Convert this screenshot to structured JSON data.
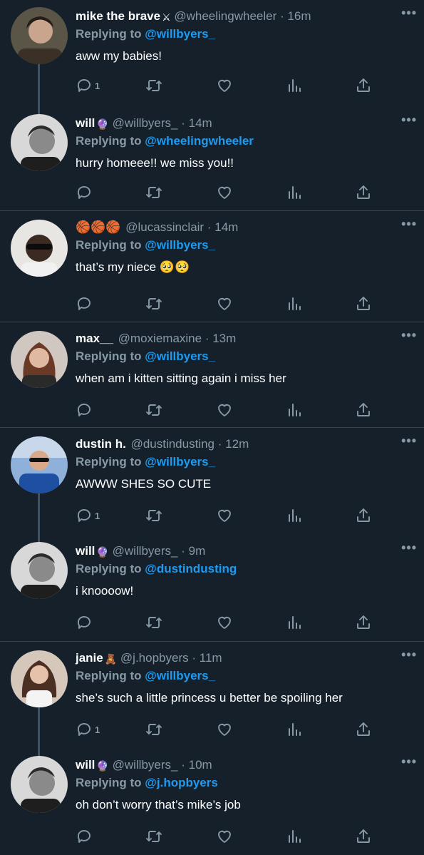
{
  "icons": {
    "more": "more-icon",
    "reply": "reply-icon",
    "retweet": "retweet-icon",
    "like": "heart-icon",
    "views": "analytics-icon",
    "share": "share-icon"
  },
  "colors": {
    "background": "#15202b",
    "muted": "#8899a6",
    "link": "#1d9bf0",
    "divider": "#38444d"
  },
  "tweets": [
    {
      "name": "mike the brave",
      "name_emoji": "⚔",
      "handle": "@wheelingwheeler",
      "separator": "·",
      "time": "16m",
      "reply_label": "Replying to",
      "reply_to": "@willbyers_",
      "text": "aww my babies!",
      "reply_count": "1",
      "more": "•••"
    },
    {
      "name": "will",
      "name_emoji": "🔮",
      "handle": "@willbyers_",
      "separator": "·",
      "time": "14m",
      "reply_label": "Replying to",
      "reply_to": "@wheelingwheeler",
      "text": "hurry homeee!! we miss you!!",
      "reply_count": "",
      "more": "•••"
    },
    {
      "name": "🏀🏀🏀",
      "name_emoji": "",
      "handle": "@lucassinclair",
      "separator": "·",
      "time": "14m",
      "reply_label": "Replying to",
      "reply_to": "@willbyers_",
      "text": "that’s my niece 🥺🥺",
      "reply_count": "",
      "more": "•••"
    },
    {
      "name": "max__",
      "name_emoji": "",
      "handle": "@moxiemaxine",
      "separator": "·",
      "time": "13m",
      "reply_label": "Replying to",
      "reply_to": "@willbyers_",
      "text": "when am i kitten sitting again i miss her",
      "reply_count": "",
      "more": "•••"
    },
    {
      "name": "dustin h.",
      "name_emoji": "",
      "handle": "@dustindusting",
      "separator": "·",
      "time": "12m",
      "reply_label": "Replying to",
      "reply_to": "@willbyers_",
      "text": "AWWW SHES SO CUTE",
      "reply_count": "1",
      "more": "•••"
    },
    {
      "name": "will",
      "name_emoji": "🔮",
      "handle": "@willbyers_",
      "separator": "·",
      "time": "9m",
      "reply_label": "Replying to",
      "reply_to": "@dustindusting",
      "text": "i knoooow!",
      "reply_count": "",
      "more": "•••"
    },
    {
      "name": "janie",
      "name_emoji": "🧸",
      "handle": "@j.hopbyers",
      "separator": "·",
      "time": "11m",
      "reply_label": "Replying to",
      "reply_to": "@willbyers_",
      "text": "she’s such a little princess u better be spoiling her",
      "reply_count": "1",
      "more": "•••"
    },
    {
      "name": "will",
      "name_emoji": "🔮",
      "handle": "@willbyers_",
      "separator": "·",
      "time": "10m",
      "reply_label": "Replying to",
      "reply_to": "@j.hopbyers",
      "text": "oh don’t worry that’s mike’s job",
      "reply_count": "",
      "more": "•••"
    }
  ]
}
